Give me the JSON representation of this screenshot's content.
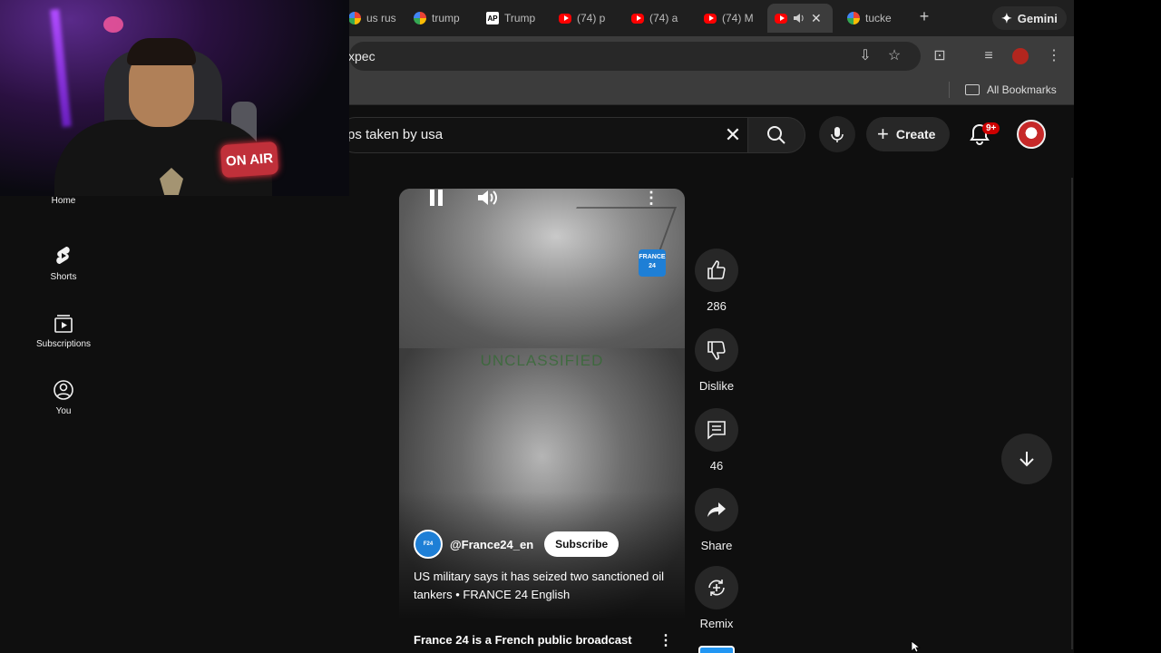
{
  "browser": {
    "tabs": [
      {
        "label": "us rus",
        "icon": "google-icon"
      },
      {
        "label": "trump",
        "icon": "google-icon"
      },
      {
        "label": "Trump",
        "icon": "ap-icon"
      },
      {
        "label": "(74) p",
        "icon": "youtube-icon"
      },
      {
        "label": "(74) a",
        "icon": "youtube-icon"
      },
      {
        "label": "(74) M",
        "icon": "youtube-icon"
      },
      {
        "label": "",
        "icon": "youtube-icon",
        "active": true
      },
      {
        "label": "tucke",
        "icon": "google-icon"
      }
    ],
    "gemini_label": "Gemini",
    "address": "xpec",
    "bookmarks_all": "All Bookmarks"
  },
  "youtube": {
    "search_value": "ps taken by usa",
    "create_label": "Create",
    "notification_badge": "9+",
    "nav": [
      {
        "label": "Home",
        "icon": "home-icon"
      },
      {
        "label": "Shorts",
        "icon": "shorts-icon"
      },
      {
        "label": "Subscriptions",
        "icon": "subscriptions-icon"
      },
      {
        "label": "You",
        "icon": "you-icon"
      }
    ],
    "short": {
      "channel": "@France24_en",
      "subscribe_label": "Subscribe",
      "title": "US military says it has seized two sanctioned oil tankers • FRANCE 24 English",
      "description": "France 24 is a French public broadcast",
      "overlay_text": "UNCLASSIFIED",
      "logo_text": "FRANCE 24"
    },
    "actions": [
      {
        "label": "286",
        "icon": "like-icon"
      },
      {
        "label": "Dislike",
        "icon": "dislike-icon"
      },
      {
        "label": "46",
        "icon": "comment-icon"
      },
      {
        "label": "Share",
        "icon": "share-icon"
      },
      {
        "label": "Remix",
        "icon": "remix-icon"
      }
    ]
  },
  "webcam": {
    "sign_text": "ON AIR"
  },
  "colors": {
    "background": "#0f0f0f",
    "accent_red": "#ff0000",
    "france24_blue": "#1e7fd6"
  }
}
